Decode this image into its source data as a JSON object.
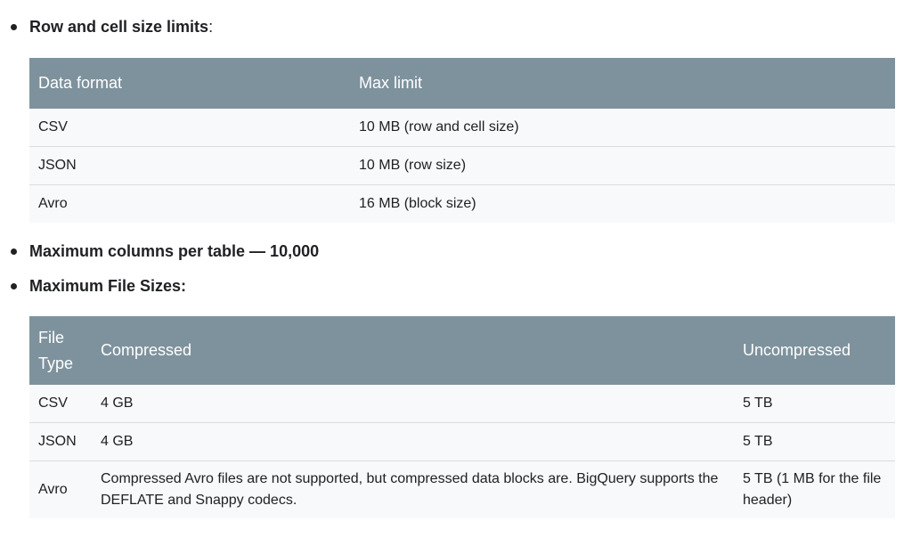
{
  "section1": {
    "bullet_bold": "Row and cell size limits",
    "bullet_suffix": ":",
    "table": {
      "headers": [
        "Data format",
        "Max limit"
      ],
      "rows": [
        [
          "CSV",
          "10 MB (row and cell size)"
        ],
        [
          "JSON",
          "10 MB (row size)"
        ],
        [
          "Avro",
          "16 MB (block size)"
        ]
      ]
    }
  },
  "section2": {
    "bullet_bold": "Maximum columns per table — 10,000"
  },
  "section3": {
    "bullet_bold": "Maximum File Sizes:",
    "table": {
      "headers": [
        "File Type",
        "Compressed",
        "Uncompressed"
      ],
      "rows": [
        [
          "CSV",
          "4 GB",
          "5 TB"
        ],
        [
          "JSON",
          "4 GB",
          "5 TB"
        ],
        [
          "Avro",
          "Compressed Avro files are not supported, but compressed data blocks are. BigQuery supports the DEFLATE and Snappy codecs.",
          "5 TB (1 MB for the file header)"
        ]
      ]
    }
  }
}
